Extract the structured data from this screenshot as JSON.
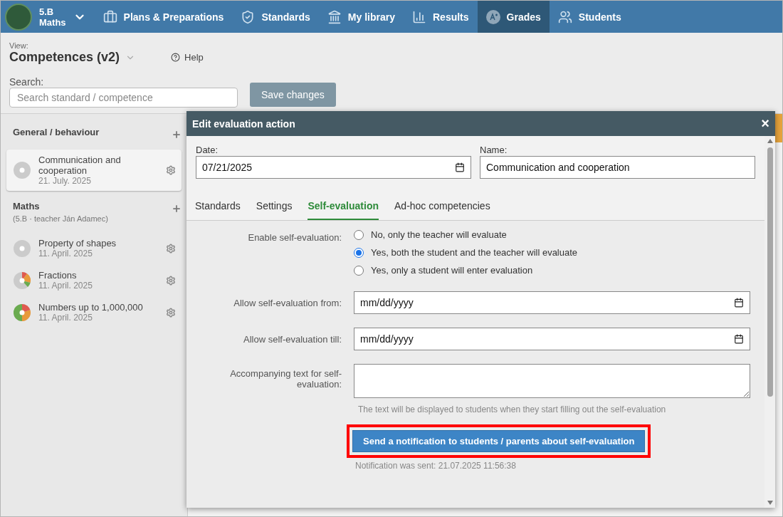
{
  "nav": {
    "class_name": "5.B",
    "subject": "Maths",
    "items": [
      {
        "kind": "plans",
        "label": "Plans & Preparations",
        "selected": false
      },
      {
        "kind": "standards",
        "label": "Standards",
        "selected": false
      },
      {
        "kind": "library",
        "label": "My library",
        "selected": false
      },
      {
        "kind": "results",
        "label": "Results",
        "selected": false
      },
      {
        "kind": "grades",
        "label": "Grades",
        "selected": true
      },
      {
        "kind": "students",
        "label": "Students",
        "selected": false
      }
    ]
  },
  "view": {
    "caption": "View:",
    "title": "Competences (v2)",
    "help": "Help"
  },
  "search": {
    "label": "Search:",
    "placeholder": "Search standard / competence"
  },
  "save_button": {
    "label": "Save changes",
    "disabled": true
  },
  "sidebar": {
    "groups": [
      {
        "title": "General / behaviour",
        "items": [
          {
            "name": "Communication and cooperation",
            "date": "21. July. 2025",
            "kind": "empty",
            "selected": true
          }
        ]
      },
      {
        "title": "Maths",
        "subtitle": "(5.B · teacher Ján Adamec)",
        "items": [
          {
            "name": "Property of shapes",
            "date": "11. April. 2025",
            "kind": "empty",
            "selected": false
          },
          {
            "name": "Fractions",
            "date": "11. April. 2025",
            "kind": "partial",
            "selected": false
          },
          {
            "name": "Numbers up to 1,000,000",
            "date": "11. April. 2025",
            "kind": "full",
            "selected": false
          }
        ]
      }
    ]
  },
  "dialog": {
    "title": "Edit evaluation action",
    "close": "×",
    "date": {
      "label": "Date:",
      "value": "07/21/2025"
    },
    "name": {
      "label": "Name:",
      "value": "Communication and cooperation"
    },
    "tabs": [
      {
        "label": "Standards",
        "selected": false
      },
      {
        "label": "Settings",
        "selected": false
      },
      {
        "label": "Self-evaluation",
        "selected": true
      },
      {
        "label": "Ad-hoc competencies",
        "selected": false
      }
    ],
    "enable": {
      "label": "Enable self-evaluation:",
      "options": [
        {
          "label": "No, only the teacher will evaluate",
          "selected": false
        },
        {
          "label": "Yes, both the student and the teacher will evaluate",
          "selected": true
        },
        {
          "label": "Yes, only a student will enter evaluation",
          "selected": false
        }
      ]
    },
    "from": {
      "label": "Allow self-evaluation from:",
      "placeholder": "mm/dd/yyyy"
    },
    "till": {
      "label": "Allow self-evaluation till:",
      "placeholder": "mm/dd/yyyy"
    },
    "text": {
      "label": "Accompanying text for self-evaluation:",
      "hint": "The text will be displayed to students when they start filling out the self-evaluation"
    },
    "notify_button": {
      "label": "Send a notification to students / parents about self-evaluation",
      "highlighted": true
    },
    "notify_status": "Notification was sent: 21.07.2025 11:56:38"
  }
}
